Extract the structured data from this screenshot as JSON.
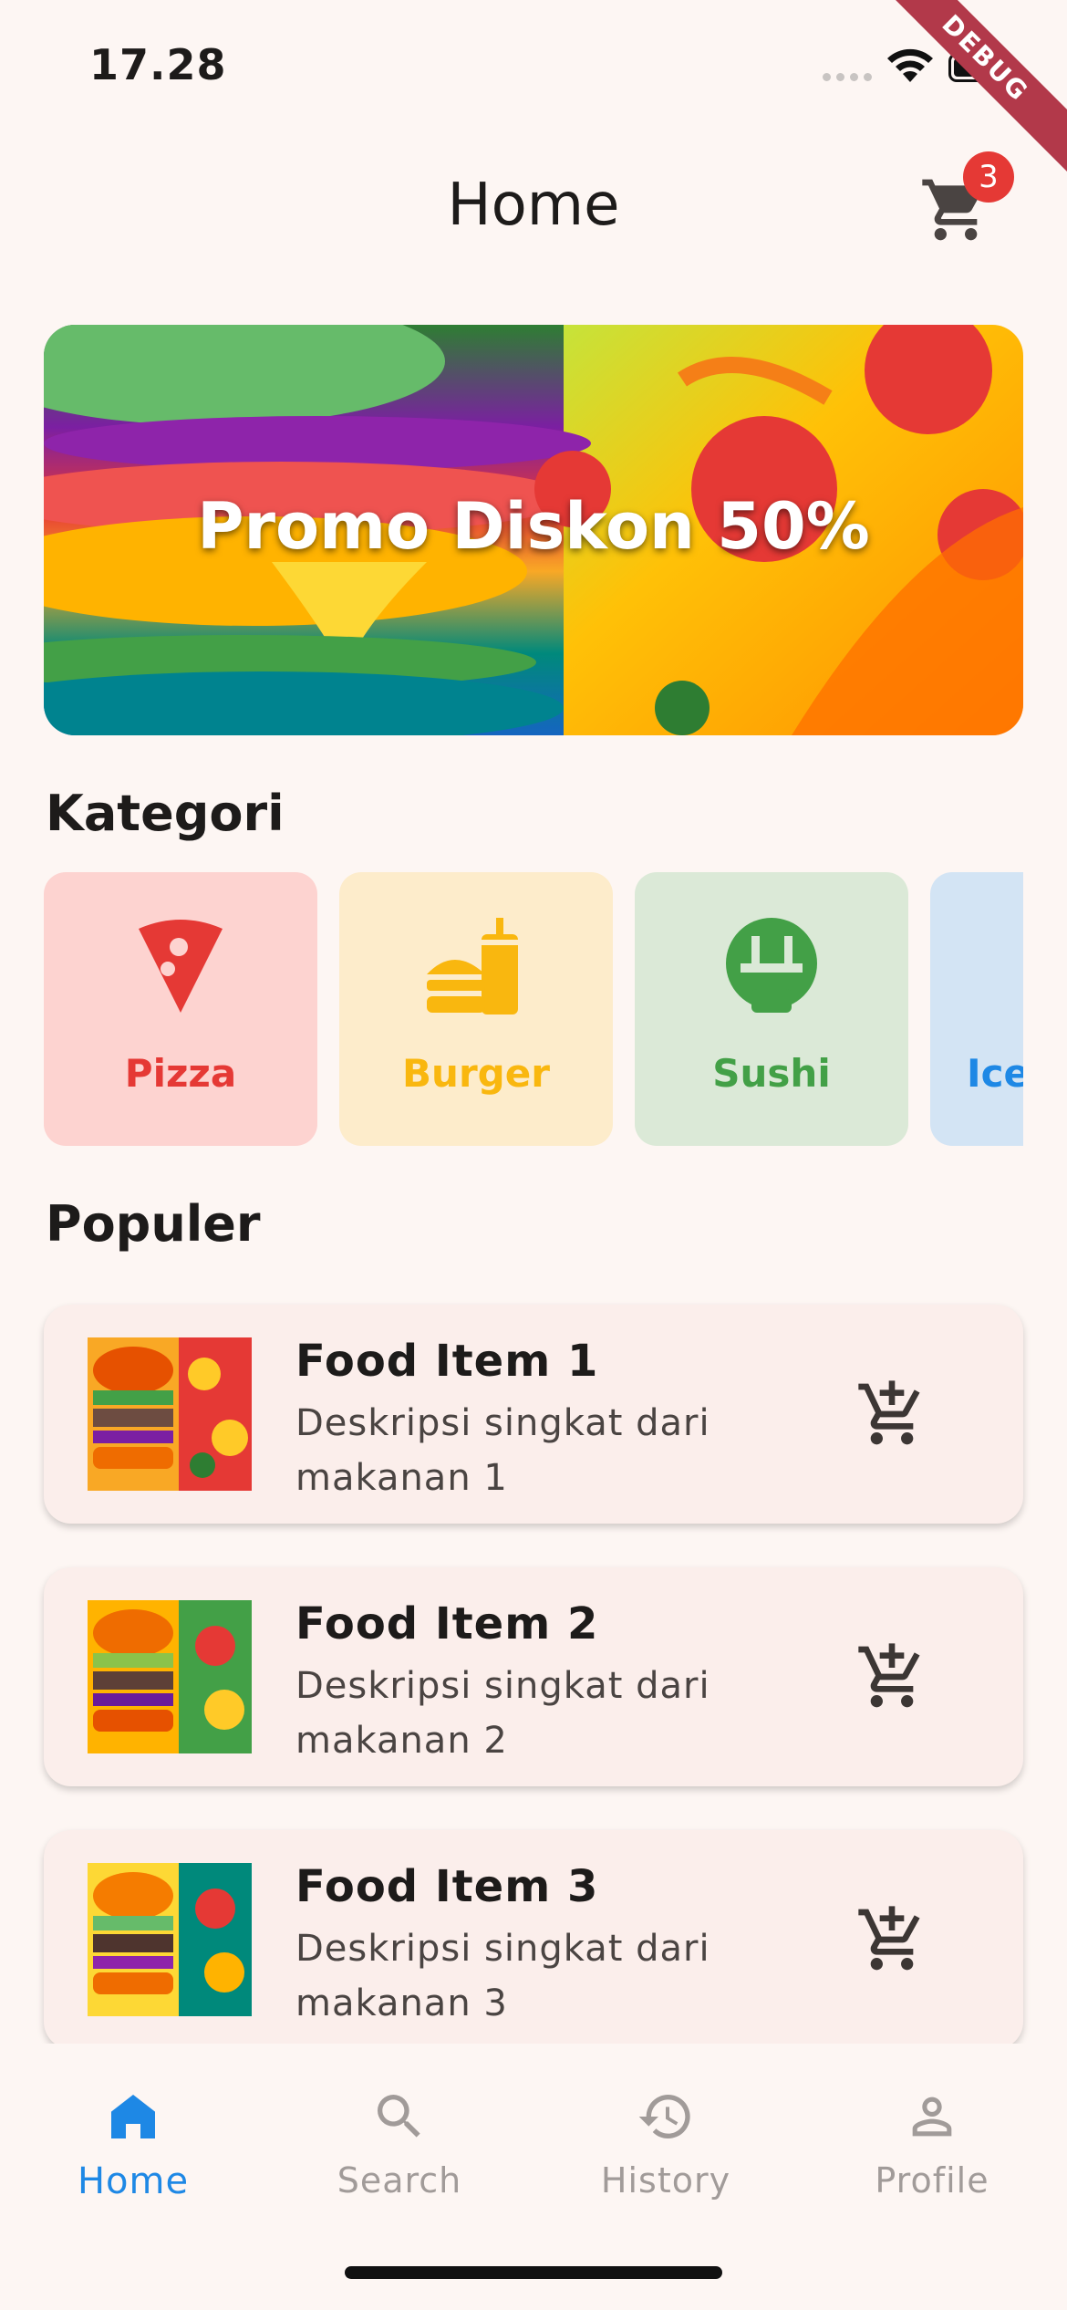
{
  "status_bar": {
    "time": "17.28",
    "debug_label": "DEBUG"
  },
  "app_bar": {
    "title": "Home",
    "cart_count": "3"
  },
  "banner": {
    "text": "Promo Diskon 50%"
  },
  "categories_section": {
    "title": "Kategori",
    "items": [
      {
        "label": "Pizza",
        "icon": "pizza-icon",
        "color": "#e53935",
        "bg": "#fdd3d0"
      },
      {
        "label": "Burger",
        "icon": "burger-icon",
        "color": "#f9b70f",
        "bg": "#fdeccb"
      },
      {
        "label": "Sushi",
        "icon": "sushi-icon",
        "color": "#43a047",
        "bg": "#dbe9d7"
      },
      {
        "label": "Ice",
        "icon": "ice-cream-icon",
        "color": "#1e88e5",
        "bg": "#d3e4f4"
      }
    ]
  },
  "popular_section": {
    "title": "Populer",
    "items": [
      {
        "name": "Food Item 1",
        "description": "Deskripsi singkat dari makanan 1"
      },
      {
        "name": "Food Item 2",
        "description": "Deskripsi singkat dari makanan 2"
      },
      {
        "name": "Food Item 3",
        "description": "Deskripsi singkat dari makanan 3"
      }
    ]
  },
  "bottom_nav": {
    "items": [
      {
        "label": "Home",
        "icon": "home-icon",
        "active": true
      },
      {
        "label": "Search",
        "icon": "search-icon",
        "active": false
      },
      {
        "label": "History",
        "icon": "history-icon",
        "active": false
      },
      {
        "label": "Profile",
        "icon": "profile-icon",
        "active": false
      }
    ]
  },
  "colors": {
    "accent": "#1e88e5",
    "badge": "#e53935",
    "background": "#fdf6f3"
  }
}
